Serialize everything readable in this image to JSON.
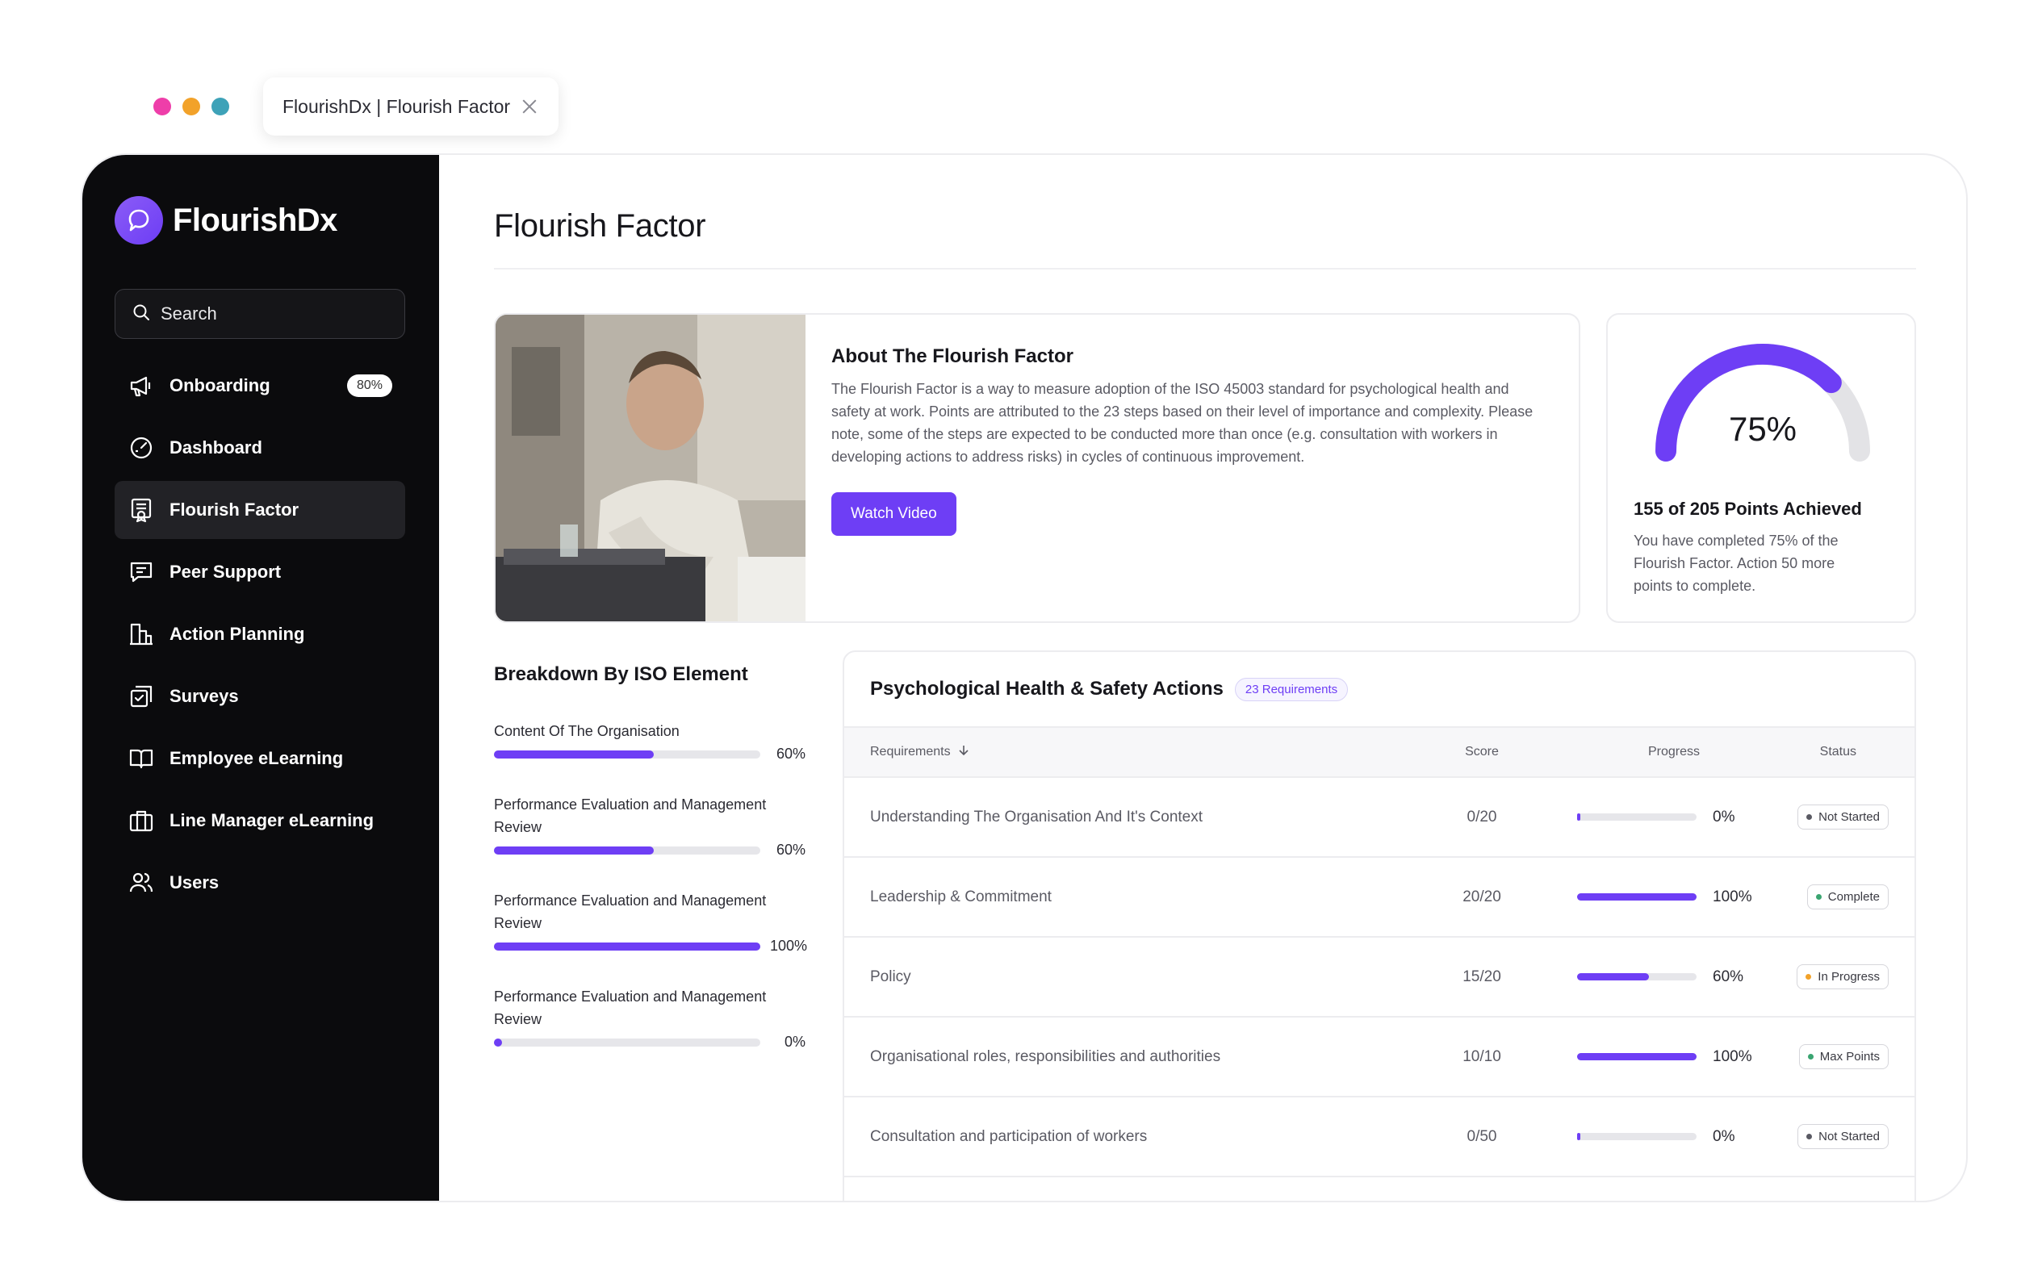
{
  "browser": {
    "window_dots": [
      "#ee3ea9",
      "#f2a22a",
      "#3ea2b8"
    ],
    "tab_title": "FlourishDx | Flourish Factor"
  },
  "sidebar": {
    "brand": "FlourishDx",
    "search_placeholder": "Search",
    "items": [
      {
        "label": "Onboarding",
        "icon": "megaphone-icon",
        "badge": "80%"
      },
      {
        "label": "Dashboard",
        "icon": "gauge-icon"
      },
      {
        "label": "Flourish Factor",
        "icon": "certificate-icon",
        "active": true
      },
      {
        "label": "Peer Support",
        "icon": "chat-icon"
      },
      {
        "label": "Action Planning",
        "icon": "buildings-icon"
      },
      {
        "label": "Surveys",
        "icon": "checklist-icon"
      },
      {
        "label": "Employee eLearning",
        "icon": "book-icon"
      },
      {
        "label": "Line Manager eLearning",
        "icon": "briefcase-icon"
      },
      {
        "label": "Users",
        "icon": "users-icon"
      }
    ]
  },
  "main": {
    "title": "Flourish Factor",
    "about": {
      "title": "About The Flourish Factor",
      "text": "The Flourish Factor is a way to measure adoption of the ISO 45003 standard for psychological health and safety at work. Points are attributed to the 23 steps based on their level of importance and complexity. Please note, some of the steps are expected to be conducted more than once (e.g. consultation with workers in developing actions to address risks) in cycles of continuous improvement.",
      "button": "Watch Video"
    },
    "score": {
      "percent": 0.75,
      "percent_label": "75%",
      "title": "155 of 205 Points Achieved",
      "text": "You have completed 75% of the Flourish Factor. Action 50 more points to complete."
    },
    "breakdown": {
      "title": "Breakdown By ISO Element",
      "items": [
        {
          "label": "Content Of The Organisation",
          "value": 0.6,
          "pct": "60%"
        },
        {
          "label": "Performance Evaluation and Management Review",
          "value": 0.6,
          "pct": "60%"
        },
        {
          "label": "Performance Evaluation and Management Review",
          "value": 1.0,
          "pct": "100%"
        },
        {
          "label": "Performance Evaluation and Management Review",
          "value": 0.0,
          "pct": "0%"
        }
      ]
    },
    "actions": {
      "title": "Psychological Health & Safety Actions",
      "badge": "23 Requirements",
      "columns": {
        "requirements": "Requirements",
        "score": "Score",
        "progress": "Progress",
        "status": "Status"
      },
      "rows": [
        {
          "req": "Understanding The Organisation And It's Context",
          "score": "0/20",
          "progress": 0.0,
          "pct": "0%",
          "status": "Not Started",
          "status_color": "#5a5a63"
        },
        {
          "req": "Leadership & Commitment",
          "score": "20/20",
          "progress": 1.0,
          "pct": "100%",
          "status": "Complete",
          "status_color": "#3aa571"
        },
        {
          "req": "Policy",
          "score": "15/20",
          "progress": 0.6,
          "pct": "60%",
          "status": "In Progress",
          "status_color": "#f2a22a"
        },
        {
          "req": "Organisational roles, responsibilities and authorities",
          "score": "10/10",
          "progress": 1.0,
          "pct": "100%",
          "status": "Max Points",
          "status_color": "#3aa571"
        },
        {
          "req": "Consultation and participation of workers",
          "score": "0/50",
          "progress": 0.0,
          "pct": "0%",
          "status": "Not Started",
          "status_color": "#5a5a63"
        }
      ]
    },
    "colors": {
      "accent": "#6e3ef5",
      "gauge_track": "#e3e3e6"
    }
  }
}
